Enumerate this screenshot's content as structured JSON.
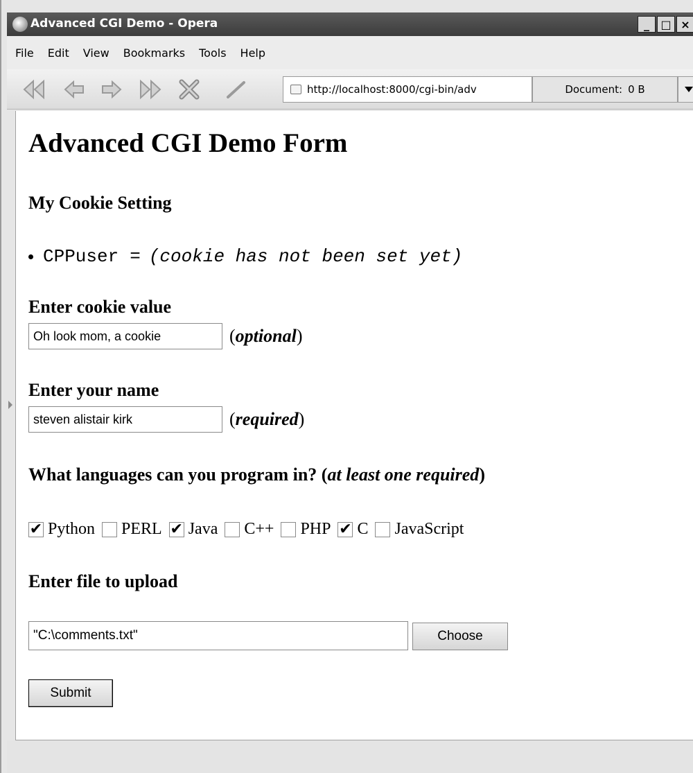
{
  "window": {
    "title": "Advanced CGI Demo - Opera",
    "controls": {
      "minimize": "_",
      "maximize": "□",
      "close": "×"
    }
  },
  "menu": [
    "File",
    "Edit",
    "View",
    "Bookmarks",
    "Tools",
    "Help"
  ],
  "toolbar": {
    "address": "http://localhost:8000/cgi-bin/adv",
    "document_label": "Document:",
    "document_size": "0 B",
    "nav_icons": [
      "rewind-icon",
      "back-icon",
      "forward-icon",
      "fast-forward-icon",
      "stop-icon",
      "edit-pencil-icon"
    ]
  },
  "page": {
    "title": "Advanced CGI Demo Form",
    "cookie_section": {
      "heading": "My Cookie Setting",
      "key": "CPPuser",
      "equals": "=",
      "value": "(cookie has not been set yet)"
    },
    "cookie_input": {
      "label": "Enter cookie value",
      "value": "Oh look mom, a cookie",
      "hint_open": "(",
      "hint": "optional",
      "hint_close": ")"
    },
    "name_input": {
      "label": "Enter your name",
      "value": "steven alistair kirk",
      "hint_open": "(",
      "hint": "required",
      "hint_close": ")"
    },
    "languages": {
      "question": "What languages can you program in?",
      "hint_open": "(",
      "hint": "at least one required",
      "hint_close": ")",
      "options": [
        {
          "label": "Python",
          "checked": true
        },
        {
          "label": "PERL",
          "checked": false
        },
        {
          "label": "Java",
          "checked": true
        },
        {
          "label": "C++",
          "checked": false
        },
        {
          "label": "PHP",
          "checked": false
        },
        {
          "label": "C",
          "checked": true
        },
        {
          "label": "JavaScript",
          "checked": false
        }
      ]
    },
    "upload": {
      "heading": "Enter file to upload",
      "value": "\"C:\\comments.txt\"",
      "choose_label": "Choose"
    },
    "submit_label": "Submit"
  }
}
